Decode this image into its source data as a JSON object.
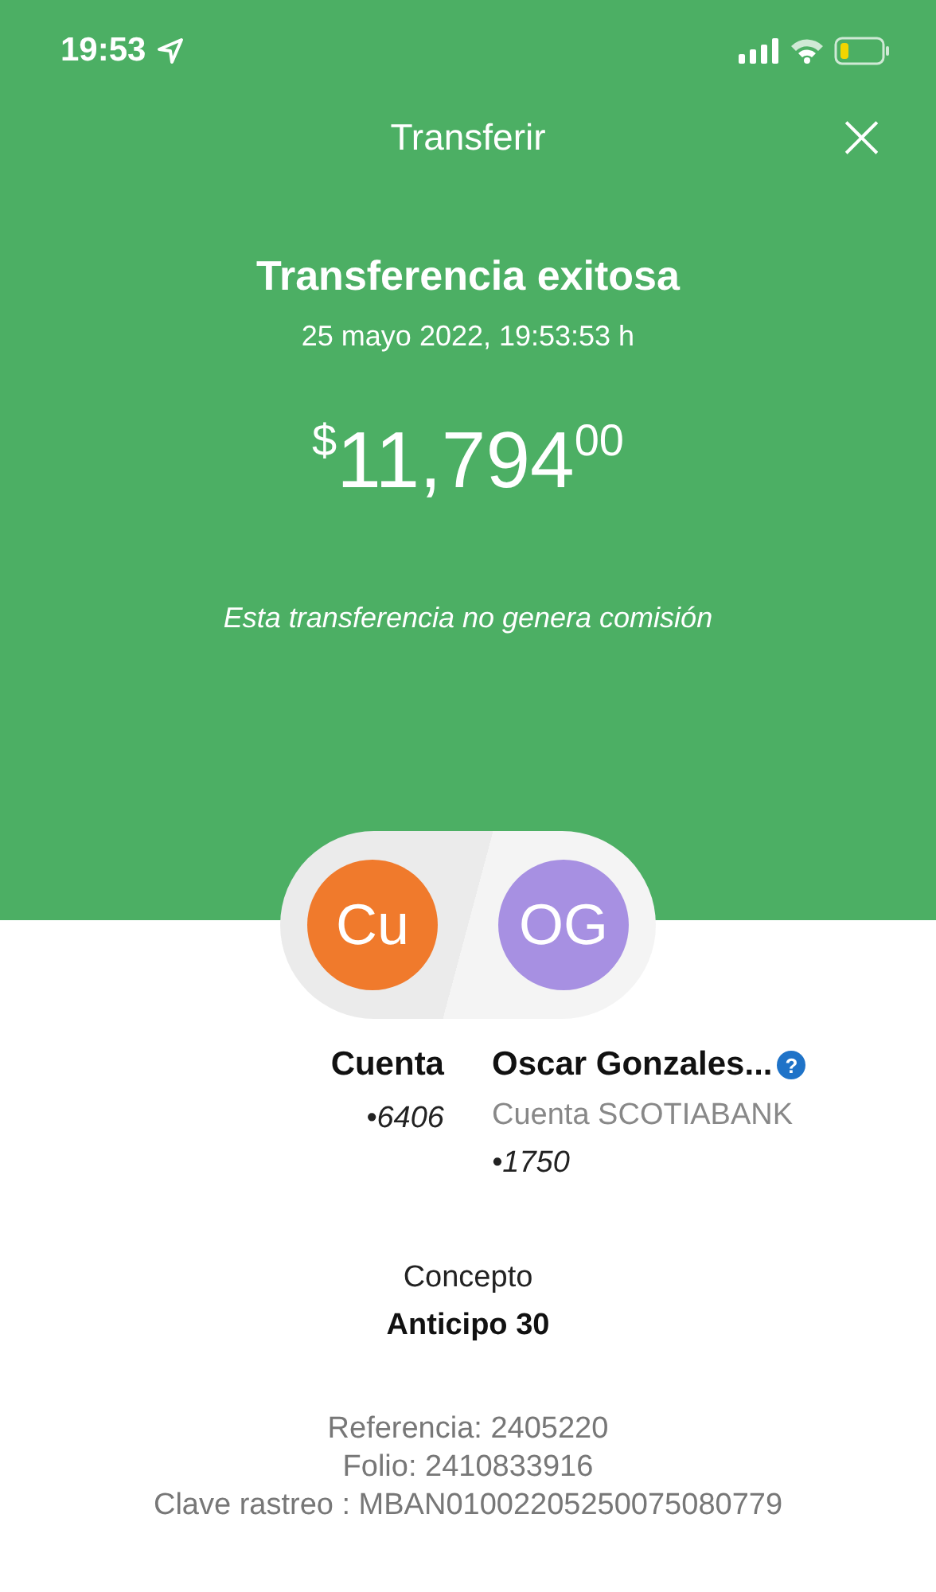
{
  "status_bar": {
    "time": "19:53"
  },
  "header": {
    "title": "Transferir",
    "close": "×"
  },
  "result": {
    "title": "Transferencia exitosa",
    "datetime": "25 mayo 2022, 19:53:53 h",
    "amount": {
      "currency": "$",
      "whole": "11,794",
      "cents": "00"
    },
    "note": "Esta transferencia no genera comisión"
  },
  "parties": [
    {
      "initials": "Cu",
      "color": "#f07a2c",
      "name": "Cuenta",
      "account": "•6406"
    },
    {
      "initials": "OG",
      "color": "#a790e2",
      "name": "Oscar Gonzales...",
      "detail": "Cuenta SCOTIABANK",
      "account": "•1750",
      "help": "?"
    }
  ],
  "concept": {
    "label": "Concepto",
    "value": "Anticipo 30"
  },
  "references": [
    "Referencia: 2405220",
    "Folio: 2410833916",
    "Clave rastreo : MBAN01002205250075080779"
  ]
}
